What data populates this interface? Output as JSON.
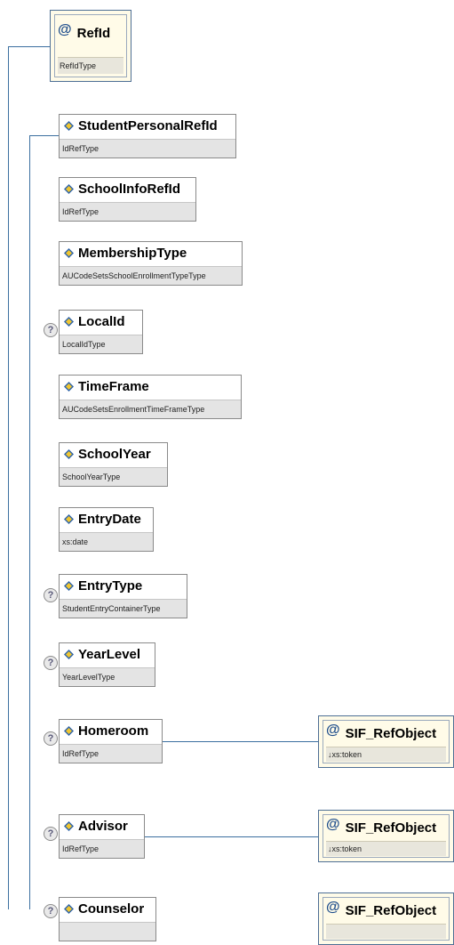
{
  "root_attribute": {
    "name": "RefId",
    "type": "RefIdType"
  },
  "elements": [
    {
      "name": "StudentPersonalRefId",
      "type": "IdRefType",
      "optional": false
    },
    {
      "name": "SchoolInfoRefId",
      "type": "IdRefType",
      "optional": false
    },
    {
      "name": "MembershipType",
      "type": "AUCodeSetsSchoolEnrollmentTypeType",
      "optional": false
    },
    {
      "name": "LocalId",
      "type": "LocalIdType",
      "optional": true
    },
    {
      "name": "TimeFrame",
      "type": "AUCodeSetsEnrollmentTimeFrameType",
      "optional": false
    },
    {
      "name": "SchoolYear",
      "type": "SchoolYearType",
      "optional": false
    },
    {
      "name": "EntryDate",
      "type": "xs:date",
      "optional": false
    },
    {
      "name": "EntryType",
      "type": "StudentEntryContainerType",
      "optional": true
    },
    {
      "name": "YearLevel",
      "type": "YearLevelType",
      "optional": true
    },
    {
      "name": "Homeroom",
      "type": "IdRefType",
      "optional": true
    },
    {
      "name": "Advisor",
      "type": "IdRefType",
      "optional": true
    },
    {
      "name": "Counselor",
      "type": "",
      "optional": true
    }
  ],
  "child_attributes": [
    {
      "name": "SIF_RefObject",
      "type": "↓xs:token"
    },
    {
      "name": "SIF_RefObject",
      "type": "↓xs:token"
    },
    {
      "name": "SIF_RefObject",
      "type": ""
    }
  ],
  "optional_marker": "?",
  "attribute_marker": "@",
  "icons": {
    "element": "element-diamond-icon",
    "optional": "question-circle-icon"
  },
  "colors": {
    "connector": "#3b6fa0",
    "attribute_fill": "#fffbe8",
    "type_bar": "#e4e4e4"
  }
}
